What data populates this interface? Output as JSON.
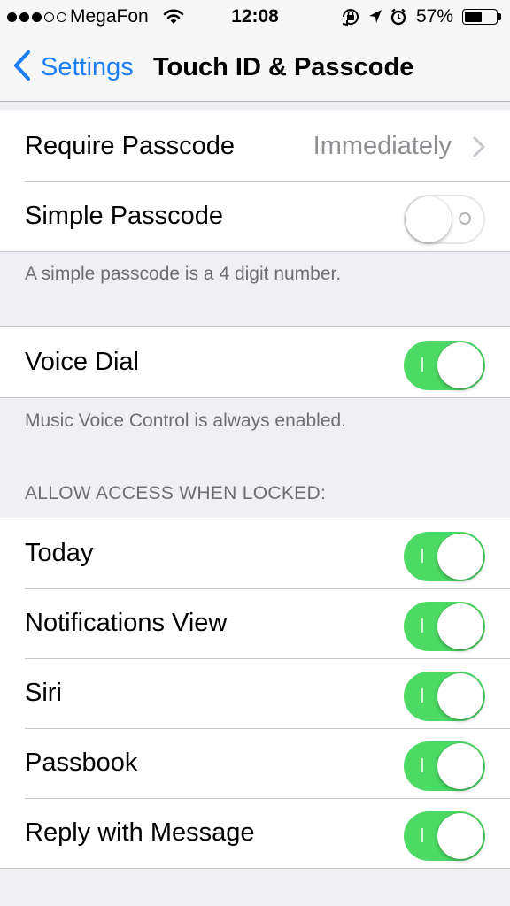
{
  "status_bar": {
    "signal_bars_filled": 3,
    "signal_bars_total": 5,
    "carrier": "MegaFon",
    "time": "12:08",
    "battery_percent": "57%",
    "battery_level": 0.57,
    "icons": [
      "wifi-icon",
      "rotation-lock-icon",
      "location-icon",
      "alarm-icon",
      "battery-icon"
    ]
  },
  "nav": {
    "back_label": "Settings",
    "title": "Touch ID & Passcode"
  },
  "passcode_group": {
    "require_label": "Require Passcode",
    "require_value": "Immediately",
    "simple_label": "Simple Passcode",
    "simple_on": false,
    "footer": "A simple passcode is a 4 digit number."
  },
  "voice_group": {
    "voice_dial_label": "Voice Dial",
    "voice_dial_on": true,
    "footer": "Music Voice Control is always enabled."
  },
  "locked_group": {
    "header": "ALLOW ACCESS WHEN LOCKED:",
    "items": [
      {
        "label": "Today",
        "on": true
      },
      {
        "label": "Notifications View",
        "on": true
      },
      {
        "label": "Siri",
        "on": true
      },
      {
        "label": "Passbook",
        "on": true
      },
      {
        "label": "Reply with Message",
        "on": true
      }
    ]
  },
  "colors": {
    "accent": "#1e7ef5",
    "switch_on": "#4cd964",
    "background": "#efeff4"
  }
}
